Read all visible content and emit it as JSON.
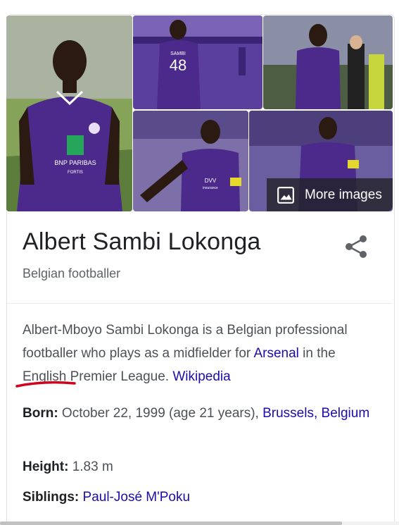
{
  "images": {
    "more_images_label": "More images",
    "jersey_number": "48",
    "jersey_name": "SAMBI",
    "sponsor_main": "BNP PARIBAS",
    "sponsor_sub": "FORTIS",
    "sponsor_alt": "DVV",
    "sponsor_alt_sub": "insurance"
  },
  "entity": {
    "name": "Albert Sambi Lokonga",
    "subtitle": "Belgian footballer"
  },
  "description": {
    "text_before": "Albert-Mboyo Sambi Lokonga is a Belgian professional footballer who plays as a midfielder for ",
    "club_link": "Arsenal",
    "text_after": " in the English Premier League. ",
    "source_link": "Wikipedia"
  },
  "facts": {
    "born_label": "Born:",
    "born_value": " October 22, 1999 (age 21 years), ",
    "born_place_link": "Brussels, Belgium",
    "height_label": "Height:",
    "height_value": " 1.83 m",
    "siblings_label": "Siblings:",
    "siblings_link": "Paul-José M'Poku"
  },
  "colors": {
    "link": "#1a0dab",
    "text": "#4d5156",
    "title": "#202124",
    "kit_purple": "#4b2a8c",
    "annotation_red": "#d0021b"
  }
}
